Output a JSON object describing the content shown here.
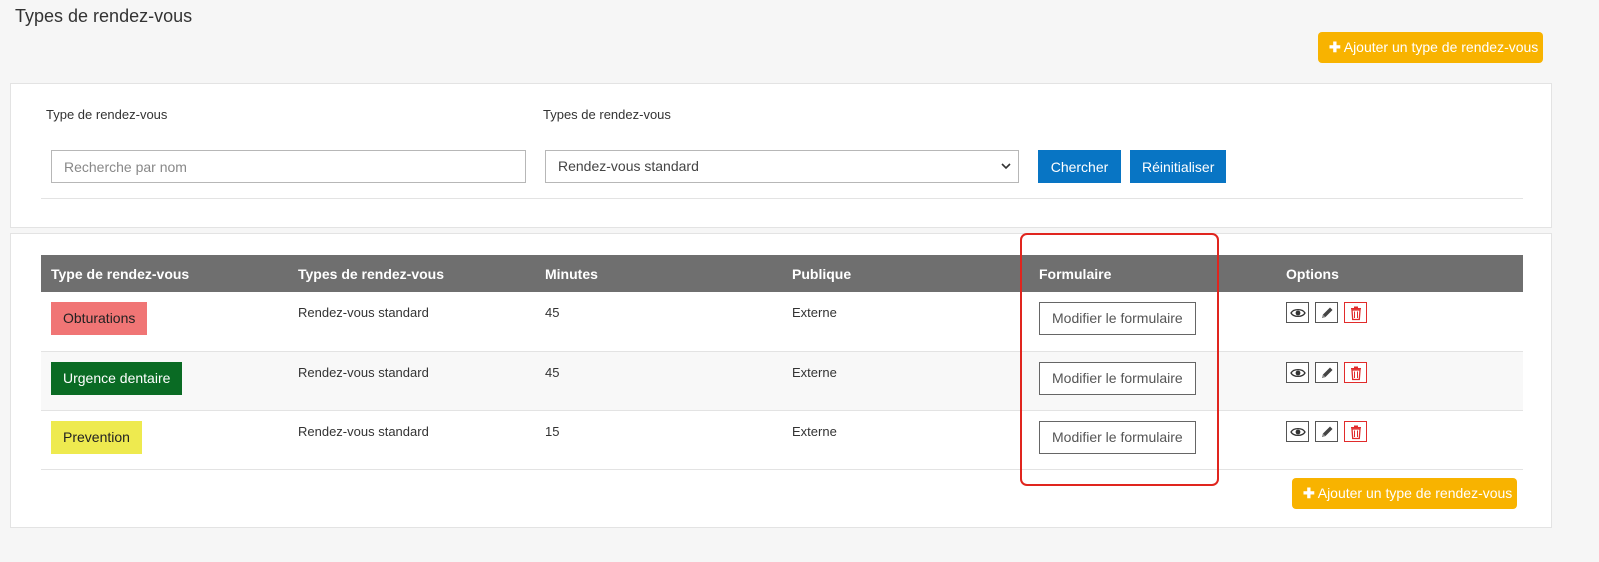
{
  "page": {
    "title": "Types de rendez-vous"
  },
  "actions": {
    "add_label": "Ajouter un type de rendez-vous",
    "add_icon": "plus-icon"
  },
  "filters": {
    "name_label": "Type de rendez-vous",
    "name_placeholder": "Recherche par nom",
    "type_label": "Types de rendez-vous",
    "type_selected": "Rendez-vous standard",
    "search_label": "Chercher",
    "reset_label": "Réinitialiser"
  },
  "table": {
    "headers": [
      "Type de rendez-vous",
      "Types de rendez-vous",
      "Minutes",
      "Publique",
      "Formulaire",
      "Options"
    ],
    "rows": [
      {
        "name": "Obturations",
        "color": "#f07575",
        "text_color": "#222222",
        "type": "Rendez-vous standard",
        "minutes": "45",
        "publique": "Externe",
        "form_label": "Modifier le formulaire"
      },
      {
        "name": "Urgence dentaire",
        "color": "#0a6b24",
        "text_color": "#ffffff",
        "type": "Rendez-vous standard",
        "minutes": "45",
        "publique": "Externe",
        "form_label": "Modifier le formulaire"
      },
      {
        "name": "Prevention",
        "color": "#eeea4f",
        "text_color": "#222222",
        "type": "Rendez-vous standard",
        "minutes": "15",
        "publique": "Externe",
        "form_label": "Modifier le formulaire"
      }
    ],
    "option_icons": [
      "eye-icon",
      "pencil-icon",
      "trash-icon"
    ]
  },
  "colors": {
    "accent_blue": "#0875c4",
    "accent_orange": "#f8b300",
    "header_gray": "#6f6f6f",
    "highlight_red": "#e0251e",
    "delete_red": "#e12b2b"
  }
}
